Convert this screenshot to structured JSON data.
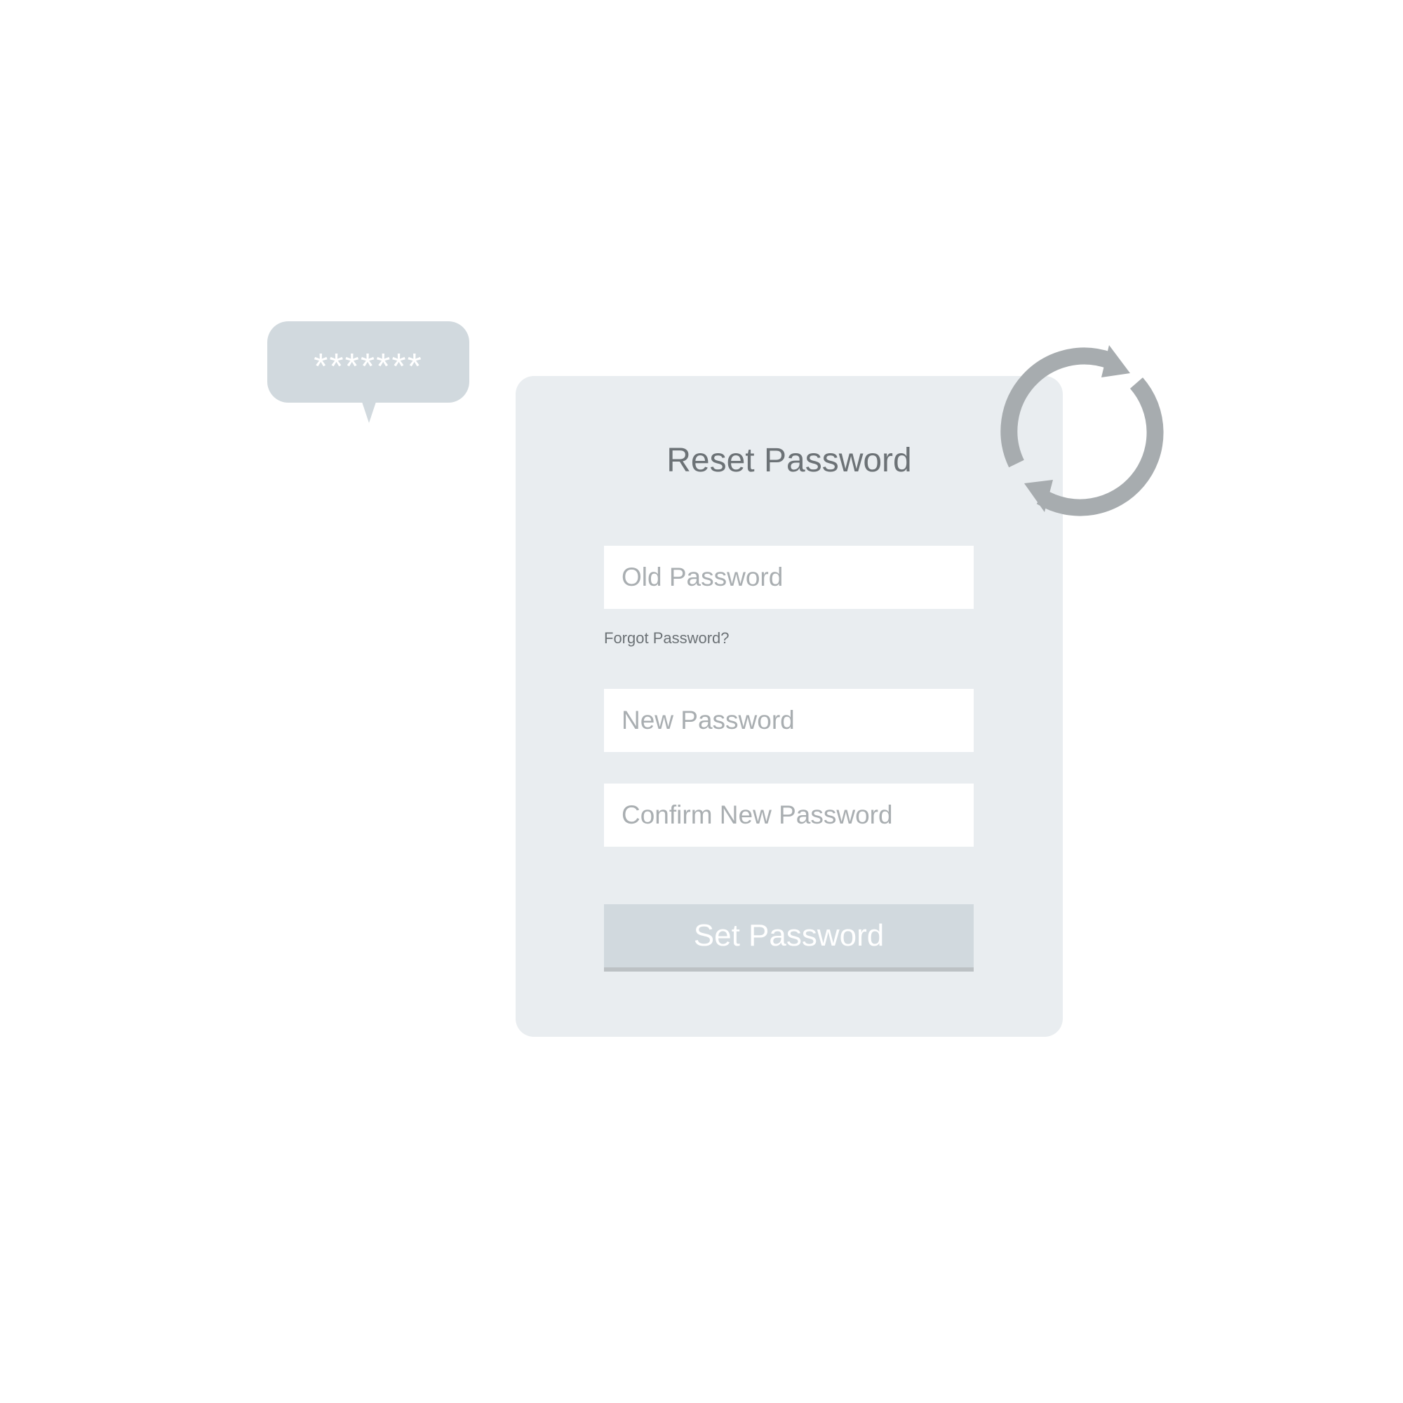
{
  "bubble": {
    "text": "*******"
  },
  "form": {
    "title": "Reset Password",
    "old_password": {
      "placeholder": "Old Password"
    },
    "forgot_label": "Forgot Password?",
    "new_password": {
      "placeholder": "New Password"
    },
    "confirm_password": {
      "placeholder": "Confirm New Password"
    },
    "submit_label": "Set Password"
  },
  "icons": {
    "refresh": "refresh-icon"
  },
  "colors": {
    "card_background": "#e9edf0",
    "bubble_background": "#d1d9de",
    "button_background": "#d1d9de",
    "title_text": "#6c7276",
    "placeholder_text": "#a9aeb1",
    "icon": "#a7acaf"
  }
}
